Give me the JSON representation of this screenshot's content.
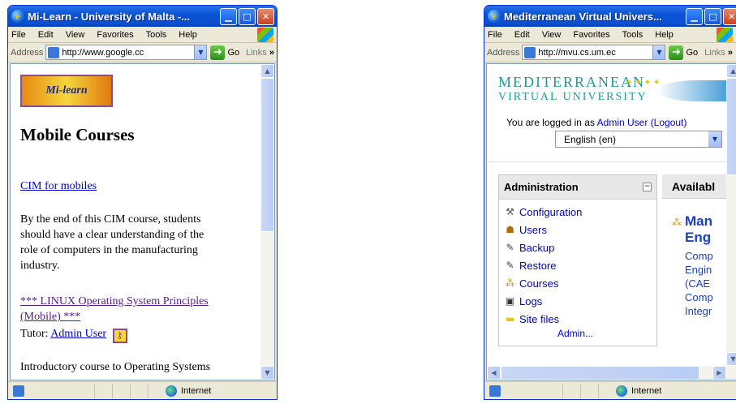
{
  "window1": {
    "title": "Mi-Learn - University of Malta -...",
    "menu": [
      "File",
      "Edit",
      "View",
      "Favorites",
      "Tools",
      "Help"
    ],
    "address_label": "Address",
    "address": "http://www.google.cc",
    "go_label": "Go",
    "links_label": "Links",
    "links_chevron": "»",
    "logo_text": "Mi-learn",
    "heading": "Mobile Courses",
    "course1_link": "CIM for mobiles",
    "course1_desc": [
      "By the end of this CIM course, students",
      "should have a clear understanding of the",
      "role of computers in the manufacturing",
      "industry."
    ],
    "course2_link_l1": "*** LINUX Operating System Principles",
    "course2_link_l2": "(Mobile) ***",
    "tutor_label": "Tutor:",
    "tutor_name": "Admin User",
    "course2_desc": "Introductory course to Operating Systems",
    "status_zone": "Internet"
  },
  "window2": {
    "title": "Mediterranean Virtual Univers...",
    "menu": [
      "File",
      "Edit",
      "View",
      "Favorites",
      "Tools",
      "Help"
    ],
    "address_label": "Address",
    "address": "http://mvu.cs.um.ec",
    "go_label": "Go",
    "links_label": "Links",
    "links_chevron": "»",
    "logo_line1": "MEDITERRANEAN",
    "logo_line2": "VIRTUAL UNIVERSITY",
    "logged_in_prefix": "You are logged in as",
    "logged_in_user": "Admin User",
    "logout_link": "(Logout)",
    "language": "English (en)",
    "admin_heading": "Administration",
    "admin_items": [
      "Configuration",
      "Users",
      "Backup",
      "Restore",
      "Courses",
      "Logs",
      "Site files"
    ],
    "admin_more": "Admin...",
    "available_heading": "Availabl",
    "course_title_l1": "Man",
    "course_title_l2": "Eng",
    "course_desc": [
      "Comp",
      "Engin",
      "(CAE",
      "Comp",
      "Integr"
    ],
    "status_zone": "Internet"
  }
}
